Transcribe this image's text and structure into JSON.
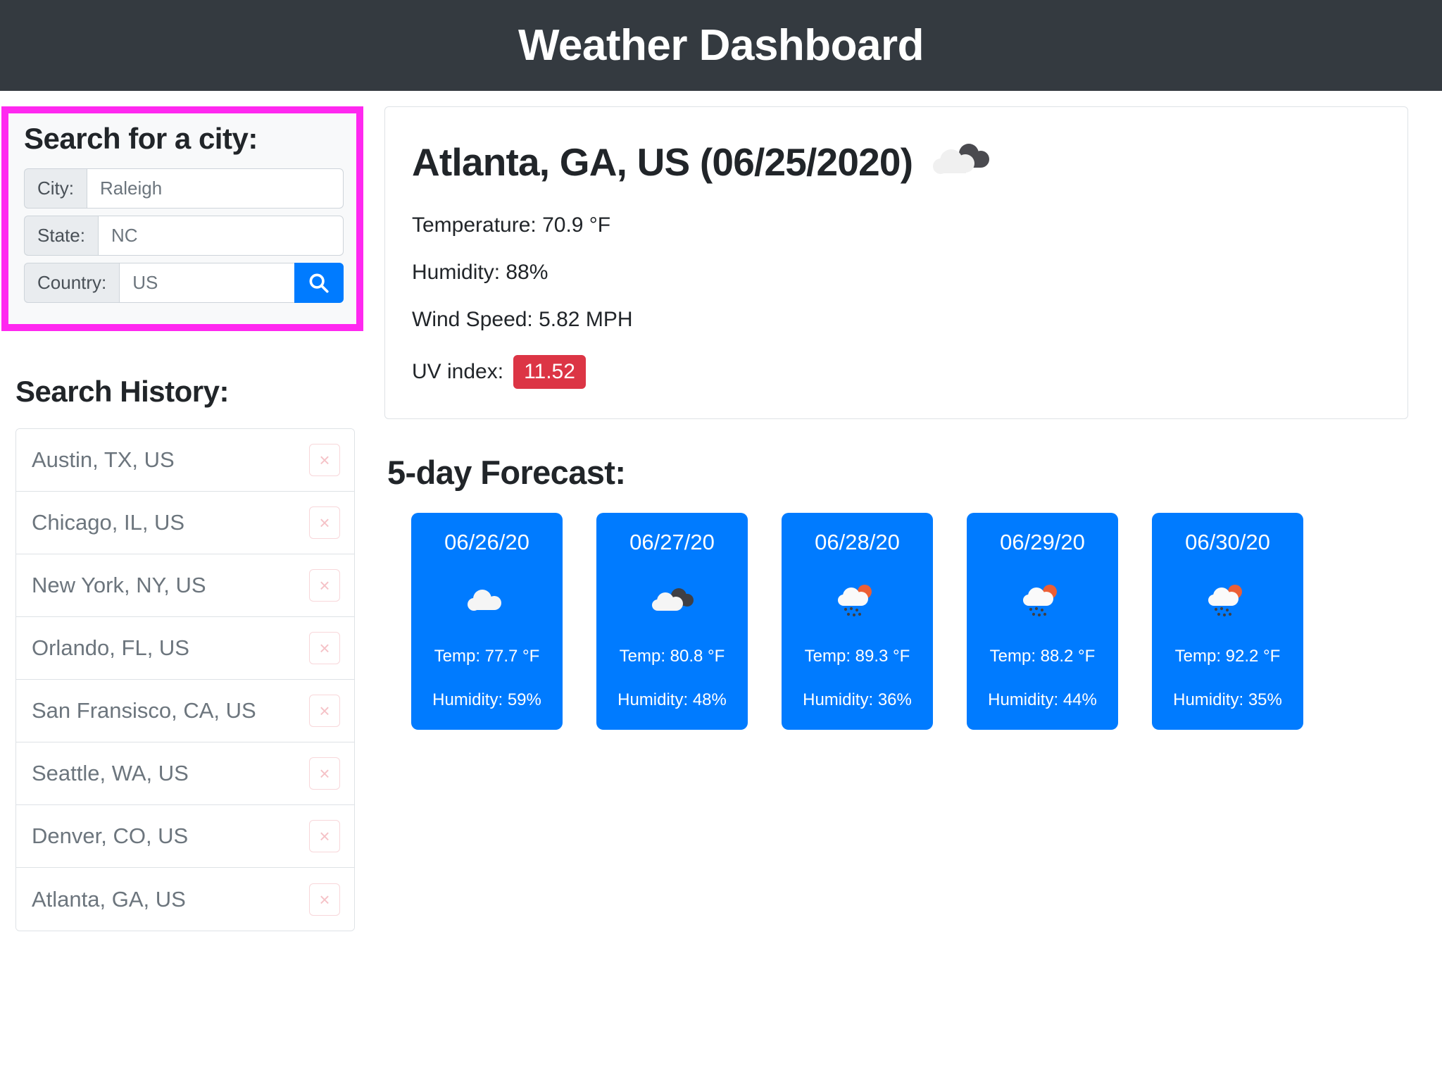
{
  "header": {
    "title": "Weather Dashboard"
  },
  "search_panel": {
    "heading": "Search for a city:",
    "highlight_color": "#ff28f0",
    "fields": [
      {
        "label": "City:",
        "value": "",
        "placeholder": "Raleigh"
      },
      {
        "label": "State:",
        "value": "",
        "placeholder": "NC"
      },
      {
        "label": "Country:",
        "value": "",
        "placeholder": "US"
      }
    ],
    "search_button_icon": "search-icon"
  },
  "history": {
    "heading": "Search History:",
    "delete_label": "×",
    "items": [
      {
        "label": "Austin, TX, US"
      },
      {
        "label": "Chicago, IL, US"
      },
      {
        "label": "New York, NY, US"
      },
      {
        "label": "Orlando, FL, US"
      },
      {
        "label": "San Fransisco, CA, US"
      },
      {
        "label": "Seattle, WA, US"
      },
      {
        "label": "Denver, CO, US"
      },
      {
        "label": "Atlanta, GA, US"
      }
    ]
  },
  "current": {
    "title": "Atlanta, GA, US (06/25/2020)",
    "icon": "broken-clouds-icon",
    "temperature": "Temperature: 70.9 °F",
    "humidity": "Humidity: 88%",
    "wind": "Wind Speed: 5.82 MPH",
    "uv_label": "UV index:",
    "uv_value": "11.52",
    "uv_color": "#dc3545"
  },
  "forecast": {
    "heading": "5-day Forecast:",
    "card_color": "#007bff",
    "cards": [
      {
        "date": "06/26/20",
        "icon": "cloud-icon",
        "temp": "Temp: 77.7 °F",
        "humidity": "Humidity: 59%"
      },
      {
        "date": "06/27/20",
        "icon": "broken-clouds-icon",
        "temp": "Temp: 80.8 °F",
        "humidity": "Humidity: 48%"
      },
      {
        "date": "06/28/20",
        "icon": "sun-cloud-rain-icon",
        "temp": "Temp: 89.3 °F",
        "humidity": "Humidity: 36%"
      },
      {
        "date": "06/29/20",
        "icon": "sun-cloud-rain-icon",
        "temp": "Temp: 88.2 °F",
        "humidity": "Humidity: 44%"
      },
      {
        "date": "06/30/20",
        "icon": "sun-cloud-rain-icon",
        "temp": "Temp: 92.2 °F",
        "humidity": "Humidity: 35%"
      }
    ]
  }
}
